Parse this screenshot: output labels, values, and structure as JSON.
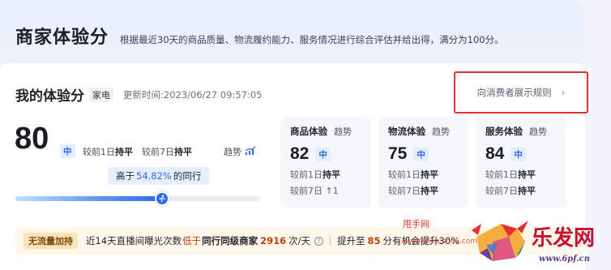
{
  "header": {
    "title": "商家体验分",
    "description": "根据最近30天的商品质量、物流履约能力、服务情况进行综合评估并给出得，满分为100分。"
  },
  "score_section": {
    "title": "我的体验分",
    "category": "家电",
    "update_time": "更新时间:2023/06/27 09:57:05",
    "rule_button": "向消费者展示规则",
    "score": "80",
    "level": "中",
    "cmp_1d_prefix": "较前1日",
    "cmp_1d_value": "持平",
    "cmp_7d_prefix": "较前7日",
    "cmp_7d_value": "持平",
    "trend_label": "趋势",
    "peer_prefix": "高于",
    "peer_percent": "54.82%",
    "peer_suffix": "的同行",
    "peer_progress_percent": 60
  },
  "sub_scores": [
    {
      "title": "商品体验",
      "trend": "趋势",
      "score": "82",
      "level": "中",
      "line1_prefix": "较前1日",
      "line1_value": "持平",
      "line2_prefix": "较前7日",
      "line2_value": "↑1"
    },
    {
      "title": "物流体验",
      "trend": "趋势",
      "score": "75",
      "level": "中",
      "line1_prefix": "较前1日",
      "line1_value": "持平",
      "line2_prefix": "较前7日",
      "line2_value": "持平"
    },
    {
      "title": "服务体验",
      "trend": "趋势",
      "score": "84",
      "level": "中",
      "line1_prefix": "较前1日",
      "line1_value": "持平",
      "line2_prefix": "较前7日",
      "line2_value": "持平"
    }
  ],
  "bottom_bar": {
    "badge": "无流量加持",
    "text_before": "近14天直播间曝光次数",
    "low": "低于",
    "peer": "同行同级商家",
    "number": "2916",
    "unit": "次/天",
    "upgrade_prefix": "提升至",
    "upgrade_value": "85",
    "upgrade_suffix": "分有机会提升3",
    "upgrade_tail": "0%"
  },
  "watermark": {
    "text": "甩手网",
    "url": "www.shuaishou.com",
    "brand": "乐发网",
    "site": "www.6pf.cn"
  },
  "colors": {
    "accent": "#2d68f2",
    "highlight_border": "#e5302f",
    "warning": "#c2410c"
  }
}
